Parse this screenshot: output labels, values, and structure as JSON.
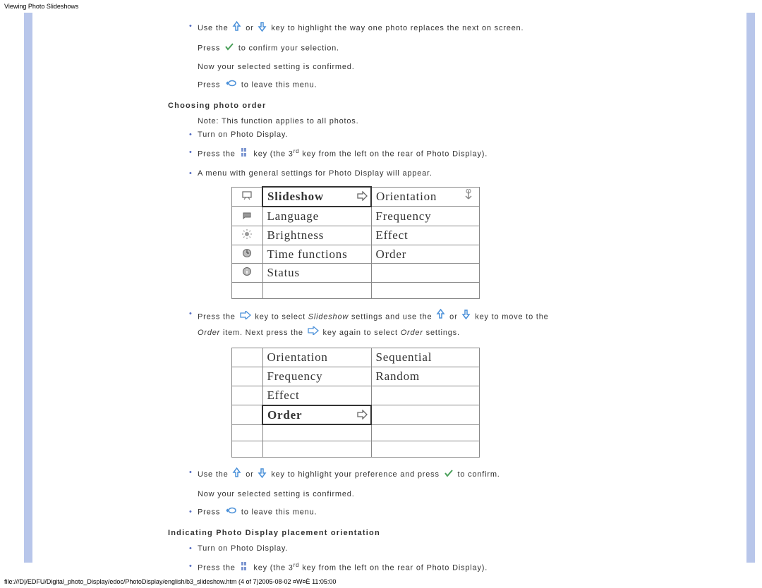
{
  "header": "Viewing Photo Slideshows",
  "footer": "file:///D|/EDFU/Digital_photo_Display/edoc/PhotoDisplay/english/b3_slideshow.htm (4 of 7)2005-08-02 ¤W¤È 11:05:00",
  "intro": {
    "line1_a": "Use the ",
    "line1_b": " or ",
    "line1_c": " key to highlight the way one photo replaces the next on screen.",
    "line2_a": "Press",
    "line2_b": " to confirm your selection.",
    "line3": "Now your selected setting is confirmed.",
    "line4_a": "Press",
    "line4_b": " to leave this menu."
  },
  "section1": {
    "title": "Choosing photo order",
    "note": "Note: This function applies to all photos.",
    "b1": "Turn on Photo Display.",
    "b2_a": "Press the ",
    "b2_b": " key (the 3",
    "b2_sup": "rd",
    "b2_c": " key from the left on the rear of Photo Display).",
    "b3": "A menu with general settings for Photo Display will appear."
  },
  "table1": {
    "r1a": "Slideshow",
    "r1b": "Orientation",
    "r2a": "Language",
    "r2b": "Frequency",
    "r3a": "Brightness",
    "r3b": "Effect",
    "r4a": "Time functions",
    "r4b": "Order",
    "r5a": "Status",
    "r5b": ""
  },
  "mid": {
    "p_a": "Press the ",
    "p_b": "key to select ",
    "p_slideshow": "Slideshow",
    "p_c": " settings and use the ",
    "p_d": "or ",
    "p_e": "key to move to the",
    "p2_order": "Order",
    "p2_a": " item.  Next press the ",
    "p2_b": " key again to select ",
    "p2_order2": "Order",
    "p2_c": " settings."
  },
  "table2": {
    "r1a": "Orientation",
    "r1b": "Sequential",
    "r2a": "Frequency",
    "r2b": "Random",
    "r3a": "Effect",
    "r3b": "",
    "r4a": "Order",
    "r4b": ""
  },
  "after": {
    "b1_a": "Use the ",
    "b1_b": " or ",
    "b1_c": "key to highlight your preference and press ",
    "b1_d": " to confirm.",
    "line2": "Now your selected setting is confirmed.",
    "b2_a": "Press",
    "b2_b": " to leave this menu."
  },
  "section2": {
    "title": "Indicating Photo Display placement orientation",
    "b1": "Turn on Photo Display.",
    "b2_a": "Press the ",
    "b2_b": " key (the 3",
    "b2_sup": "rd",
    "b2_c": " key from the left on the rear of Photo Display)."
  }
}
